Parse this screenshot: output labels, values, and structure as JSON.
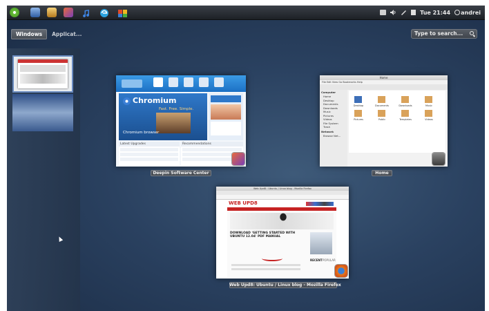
{
  "topbar": {
    "launchers": [
      {
        "icon": "ubuntu-swirl-icon",
        "color": "#6cbf3c"
      },
      {
        "icon": "desktop-icon",
        "color": "#3d6fb8"
      },
      {
        "icon": "settings-icon",
        "color": "#d9a035"
      },
      {
        "icon": "software-center-icon",
        "color": "#c8542e"
      },
      {
        "icon": "music-icon",
        "color": "#2f6fd3"
      },
      {
        "icon": "browser-icon",
        "color": "#2aa3e0"
      },
      {
        "icon": "chromium-icon",
        "color": "#e0a020"
      }
    ],
    "clock": "Tue 21:44",
    "user": "andrei"
  },
  "tabs": {
    "windows": "Windows",
    "applications": "Applicat..."
  },
  "search": {
    "placeholder": "Type to search..."
  },
  "windows": [
    {
      "caption": "Deepin Software Center",
      "app": "software-center"
    },
    {
      "caption": "Home",
      "app": "file-manager"
    },
    {
      "caption": "Web Upd8: Ubuntu / Linux blog - Mozilla Firefox",
      "app": "firefox"
    }
  ],
  "deepin": {
    "brand": "Chromium",
    "subtitle": "Fast. Free. Simple.",
    "banner": "Chromium browser",
    "latest": "Latest Upgrades",
    "recommend": "Recommendations"
  },
  "home": {
    "title": "Home",
    "menu": "File  Edit  View  Go  Bookmarks  Help",
    "sidebar_computer": "Computer",
    "sidebar_network": "Network",
    "places": [
      "Home",
      "Desktop",
      "Documents",
      "Downloads",
      "Music",
      "Pictures",
      "Videos",
      "File System",
      "Trash"
    ],
    "network_item": "Browse Net...",
    "folders": [
      "Desktop",
      "Documents",
      "Downloads",
      "Music",
      "Pictures",
      "Public",
      "Templates",
      "Videos"
    ]
  },
  "firefox": {
    "title": "Web Upd8 : Ubuntu / Linux blog - Mozilla Firefox",
    "site": "WEB UPD8",
    "headline": "DOWNLOAD 'GETTING STARTED WITH UBUNTU 12.04' PDF MANUAL",
    "recent": "RECENT",
    "popular": "POPULAR"
  }
}
